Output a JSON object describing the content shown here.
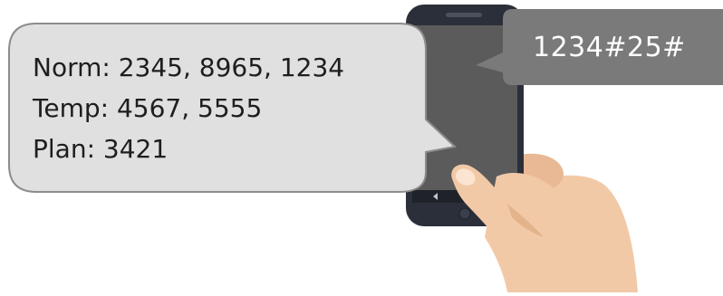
{
  "reply_bubble": {
    "lines": [
      "Norm: 2345, 8965, 1234",
      "Temp: 4567, 5555",
      "Plan: 3421"
    ]
  },
  "ussd_bubble": {
    "code": "1234#25#"
  },
  "phone": {
    "nav_icons": [
      "back-icon",
      "home-icon",
      "recents-icon"
    ]
  },
  "colors": {
    "phone_body": "#2b2f3a",
    "phone_screen": "#5b5b5b",
    "reply_bubble_fill": "#e0e0e0",
    "reply_bubble_stroke": "#8c8c8c",
    "ussd_bubble_fill": "#7a7a7a",
    "skin": "#f2c9a6",
    "skin_shadow": "#e3b48c"
  }
}
